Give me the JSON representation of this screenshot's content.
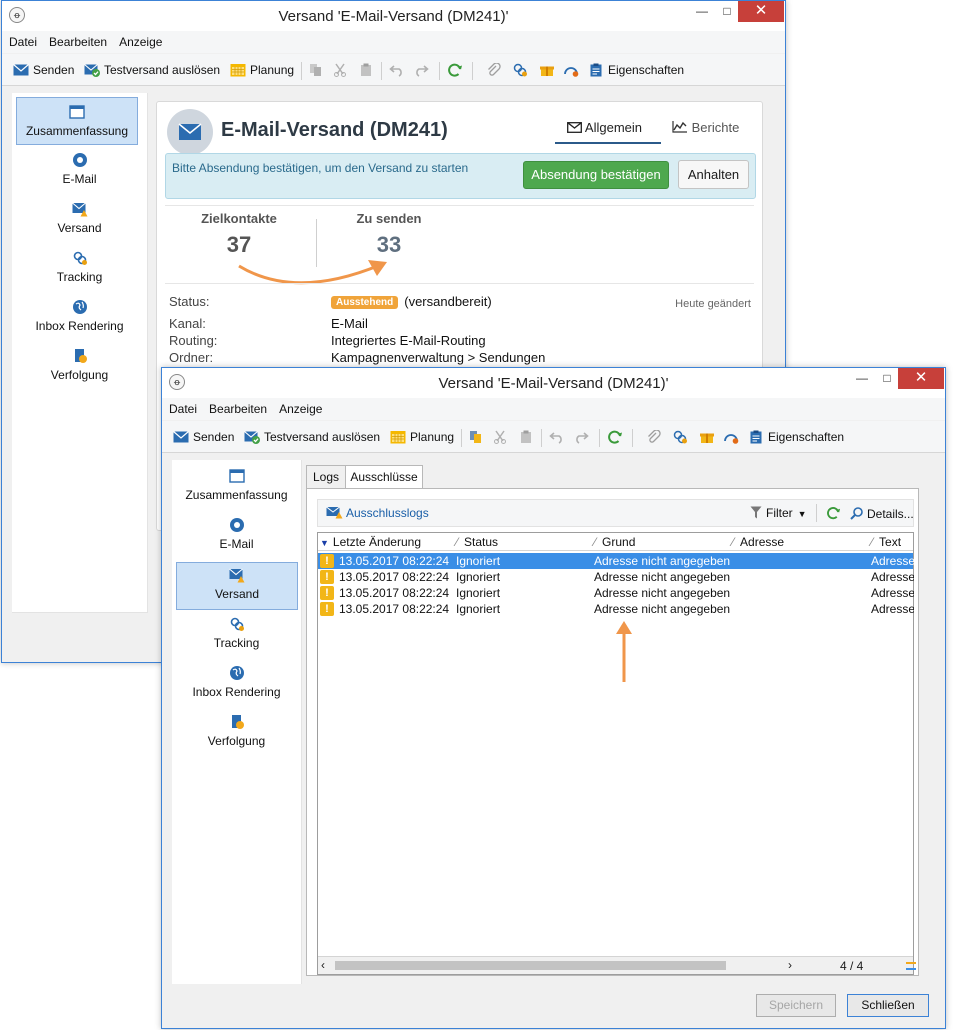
{
  "window_back": {
    "title": "Versand 'E-Mail-Versand (DM241)'",
    "menu": [
      "Datei",
      "Bearbeiten",
      "Anzeige"
    ],
    "toolbar": {
      "send": "Senden",
      "test_send": "Testversand auslösen",
      "schedule": "Planung",
      "properties": "Eigenschaften"
    },
    "nav": [
      "Zusammenfassung",
      "E-Mail",
      "Versand",
      "Tracking",
      "Inbox Rendering",
      "Verfolgung"
    ],
    "nav_selected": "Zusammenfassung",
    "summary": {
      "title": "E-Mail-Versand (DM241)",
      "tab_general": "Allgemein",
      "tab_reports": "Berichte",
      "alert_text": "Bitte Absendung bestätigen, um den Versand zu starten",
      "confirm_button": "Absendung bestätigen",
      "stop_button": "Anhalten",
      "kpi_targets_label": "Zielkontakte",
      "kpi_targets_value": "37",
      "kpi_tosend_label": "Zu senden",
      "kpi_tosend_value": "33",
      "status_label": "Status:",
      "status_badge": "Ausstehend",
      "status_text": "(versandbereit)",
      "modified": "Heute geändert",
      "channel_label": "Kanal:",
      "channel_value": "E-Mail",
      "routing_label": "Routing:",
      "routing_value": "Integriertes E-Mail-Routing",
      "folder_label": "Ordner:",
      "folder_value": "Kampagnenverwaltung > Sendungen"
    }
  },
  "window_front": {
    "title": "Versand 'E-Mail-Versand (DM241)'",
    "menu": [
      "Datei",
      "Bearbeiten",
      "Anzeige"
    ],
    "toolbar": {
      "send": "Senden",
      "test_send": "Testversand auslösen",
      "schedule": "Planung",
      "properties": "Eigenschaften"
    },
    "nav": [
      "Zusammenfassung",
      "E-Mail",
      "Versand",
      "Tracking",
      "Inbox Rendering",
      "Verfolgung"
    ],
    "nav_selected": "Versand",
    "tabs": [
      "Logs",
      "Ausschlüsse"
    ],
    "active_tab": "Ausschlüsse",
    "subbar": {
      "exclusion_logs": "Ausschlusslogs",
      "filter": "Filter",
      "details": "Details..."
    },
    "grid": {
      "columns": [
        "Letzte Änderung",
        "Status",
        "Grund",
        "Adresse",
        "Text"
      ],
      "rows": [
        {
          "date": "13.05.2017 08:22:24",
          "status": "Ignoriert",
          "reason": "Adresse nicht angegeben",
          "address": "",
          "text": "Adresse n"
        },
        {
          "date": "13.05.2017 08:22:24",
          "status": "Ignoriert",
          "reason": "Adresse nicht angegeben",
          "address": "",
          "text": "Adresse n"
        },
        {
          "date": "13.05.2017 08:22:24",
          "status": "Ignoriert",
          "reason": "Adresse nicht angegeben",
          "address": "",
          "text": "Adresse n"
        },
        {
          "date": "13.05.2017 08:22:24",
          "status": "Ignoriert",
          "reason": "Adresse nicht angegeben",
          "address": "",
          "text": "Adresse n"
        }
      ],
      "pager": "4 / 4"
    },
    "buttons": {
      "save": "Speichern",
      "close": "Schließen"
    }
  },
  "colors": {
    "window_border": "#3c82d6",
    "close_button": "#c7403a",
    "selection": "#3a8ee6",
    "confirm_green": "#4ea84e",
    "badge_orange": "#f0a43a",
    "annotation_arrow": "#f0964a"
  }
}
